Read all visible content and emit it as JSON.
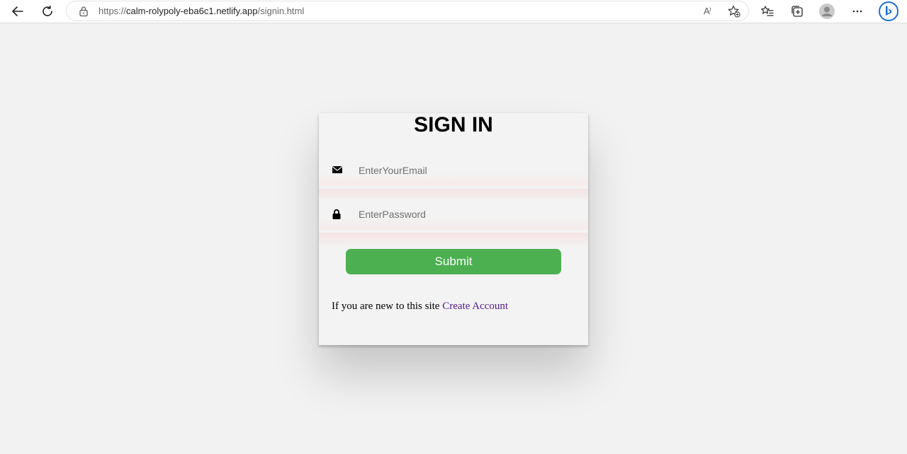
{
  "browser": {
    "url_protocol": "https://",
    "url_host": "calm-rolypoly-eba6c1.netlify.app",
    "url_path": "/signin.html",
    "read_aloud_label": "A⁾",
    "icons": {
      "back": "arrow-left-icon",
      "refresh": "refresh-icon",
      "lock": "lock-icon",
      "add_favorite": "star-add-icon",
      "favorites": "favorites-list-icon",
      "collections": "collections-icon",
      "profile": "profile-avatar-icon",
      "more": "more-dots-icon",
      "bing": "bing-icon"
    }
  },
  "signin": {
    "title": "SIGN IN",
    "email_placeholder": "EnterYourEmail",
    "email_value": "",
    "password_placeholder": "EnterPassword",
    "password_value": "",
    "submit_label": "Submit",
    "new_user_text": "If you are new to this site ",
    "create_account_label": "Create Account",
    "icons": {
      "email": "envelope-icon",
      "password": "lock-icon"
    }
  },
  "colors": {
    "page_bg": "#f2f2f2",
    "card_bg": "#f3f3f3",
    "submit_bg": "#4caf50",
    "link": "#551a8b",
    "bing_blue": "#1b6fd8"
  }
}
